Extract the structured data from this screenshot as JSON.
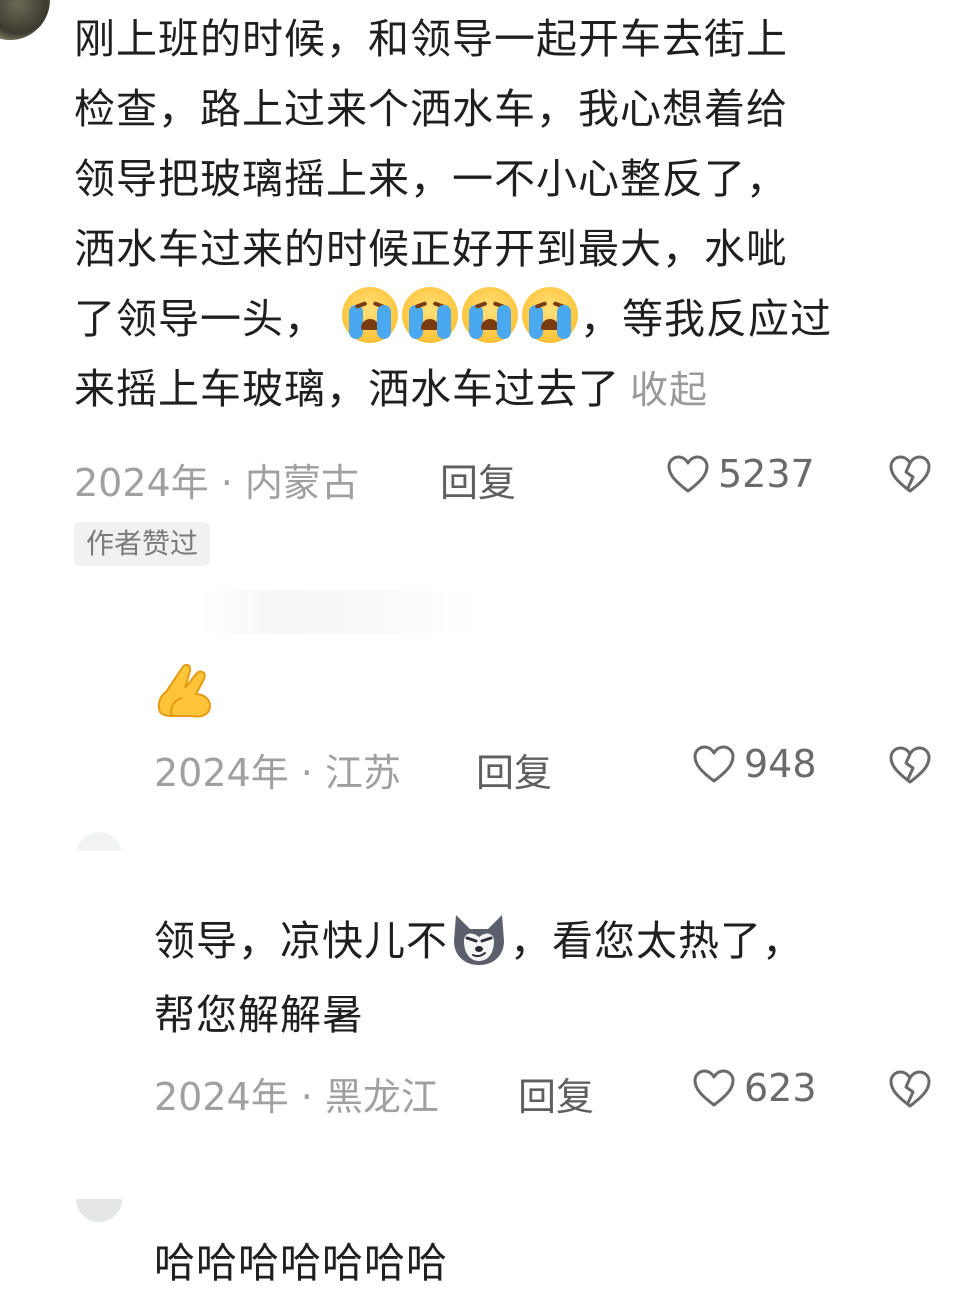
{
  "comments": [
    {
      "text_lines": [
        "刚上班的时候，和领导一起开车去街上",
        "检查，路上过来个洒水车，我心想着给",
        "领导把玻璃摇上来，一不小心整反了，",
        "洒水车过来的时候正好开到最大，水呲",
        "了领导一头，",
        "，等我反应过",
        "来摇上车玻璃，洒水车过去了"
      ],
      "collapse_label": "收起",
      "emojis": [
        "crying-face",
        "crying-face",
        "crying-face",
        "crying-face"
      ],
      "year": "2024年",
      "separator": "·",
      "location": "内蒙古",
      "reply_label": "回复",
      "likes": "5237",
      "badge": "作者赞过"
    },
    {
      "emoji": "prayer-hands",
      "year": "2024年",
      "separator": "·",
      "location": "江苏",
      "reply_label": "回复",
      "likes": "948"
    },
    {
      "text_line1_a": "领导，凉快儿不",
      "text_line1_b": "，看您太热了，",
      "text_line2": "帮您解解暑",
      "emoji": "husky-face",
      "year": "2024年",
      "separator": "·",
      "location": "黑龙江",
      "reply_label": "回复",
      "likes": "623"
    },
    {
      "text": "哈哈哈哈哈哈哈"
    }
  ],
  "colors": {
    "text": "#1f1f1f",
    "meta": "#a0a0a0",
    "emoji_yellow": "#ffc43a",
    "tear_blue": "#4aa8f0"
  }
}
